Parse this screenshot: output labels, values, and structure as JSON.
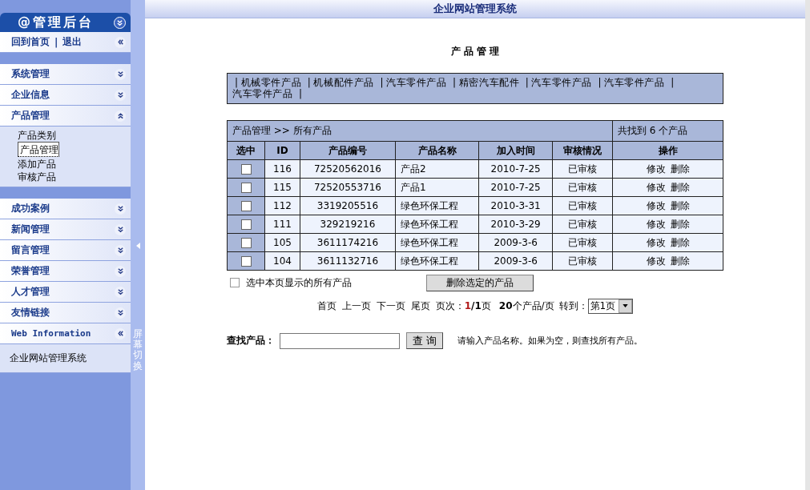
{
  "sidebar": {
    "header": {
      "title": "@管理后台"
    },
    "top_links": [
      "回到首页",
      "退出"
    ],
    "top_links_separator": "|",
    "groups": [
      {
        "sections": [
          {
            "kind": "collapsible",
            "label": "系统管理",
            "expanded": false
          },
          {
            "kind": "collapsible",
            "label": "企业信息",
            "expanded": false
          },
          {
            "kind": "collapsible",
            "label": "产品管理",
            "expanded": true,
            "children": [
              {
                "label": "产品类别",
                "selected": false
              },
              {
                "label": "产品管理",
                "selected": true
              },
              {
                "label": "添加产品",
                "selected": false
              },
              {
                "label": "审核产品",
                "selected": false
              }
            ]
          }
        ]
      },
      {
        "sections": [
          {
            "kind": "collapsible",
            "label": "成功案例",
            "expanded": false
          },
          {
            "kind": "collapsible",
            "label": "新闻管理",
            "expanded": false
          },
          {
            "kind": "collapsible",
            "label": "留言管理",
            "expanded": false
          },
          {
            "kind": "collapsible",
            "label": "荣誉管理",
            "expanded": false
          },
          {
            "kind": "collapsible",
            "label": "人才管理",
            "expanded": false
          },
          {
            "kind": "collapsible",
            "label": "友情链接",
            "expanded": false
          },
          {
            "kind": "panel",
            "label": "Web Information",
            "expanded": true,
            "children": [
              {
                "label": "企业网站管理系统",
                "selected": false
              }
            ]
          }
        ]
      }
    ]
  },
  "splitter": {
    "label": "屏幕切换"
  },
  "top_bar": {
    "title": "企业网站管理系统"
  },
  "page_title": "产 品 管 理",
  "category_separator": "|",
  "categories": [
    "机械零件产品",
    "机械配件产品",
    "汽车零件产品",
    "精密汽车配件",
    "汽车零件产品",
    "汽车零件产品",
    "汽车零件产品"
  ],
  "table": {
    "breadcrumb": "产品管理 >> 所有产品",
    "count": "共找到 6 个产品",
    "columns": [
      "选中",
      "ID",
      "产品编号",
      "产品名称",
      "加入时间",
      "审核情况",
      "操作"
    ],
    "rows": [
      {
        "checked": false,
        "id": "116",
        "code": "72520562016",
        "name": "产品2",
        "date": "2010-7-25",
        "status": "已审核",
        "actions": [
          "修改",
          "删除"
        ]
      },
      {
        "checked": false,
        "id": "115",
        "code": "72520553716",
        "name": "产品1",
        "date": "2010-7-25",
        "status": "已审核",
        "actions": [
          "修改",
          "删除"
        ]
      },
      {
        "checked": false,
        "id": "112",
        "code": "3319205516",
        "name": "绿色环保工程",
        "date": "2010-3-31",
        "status": "已审核",
        "actions": [
          "修改",
          "删除"
        ]
      },
      {
        "checked": false,
        "id": "111",
        "code": "329219216",
        "name": "绿色环保工程",
        "date": "2010-3-29",
        "status": "已审核",
        "actions": [
          "修改",
          "删除"
        ]
      },
      {
        "checked": false,
        "id": "105",
        "code": "3611174216",
        "name": "绿色环保工程",
        "date": "2009-3-6",
        "status": "已审核",
        "actions": [
          "修改",
          "删除"
        ]
      },
      {
        "checked": false,
        "id": "104",
        "code": "3611132716",
        "name": "绿色环保工程",
        "date": "2009-3-6",
        "status": "已审核",
        "actions": [
          "修改",
          "删除"
        ]
      }
    ]
  },
  "select_all": {
    "label": "选中本页显示的所有产品",
    "checked": false
  },
  "delete_button": "删除选定的产品",
  "pagination": {
    "links": [
      "首页",
      "上一页",
      "下一页",
      "尾页"
    ],
    "page_label": "页次：",
    "current_page": "1",
    "page_total": "**/1**页",
    "per_page": "**20**个产品/页",
    "goto_label": "转到：",
    "page_select": "第1页"
  },
  "search": {
    "label": "查找产品：",
    "button": "查 询",
    "hint": "请输入产品名称。如果为空，则查找所有产品。"
  }
}
